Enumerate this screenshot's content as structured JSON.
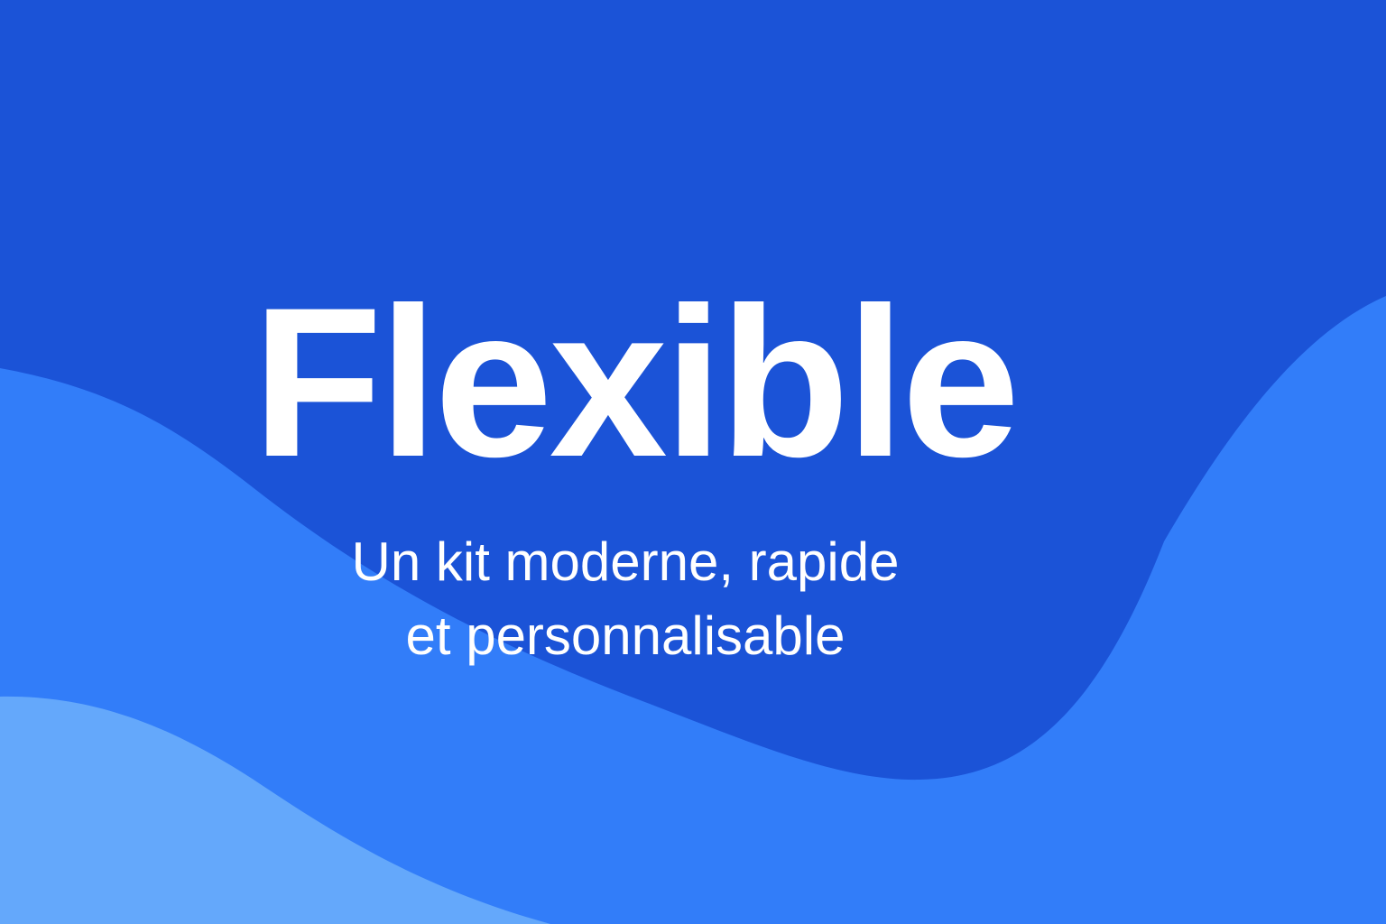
{
  "hero": {
    "title": "Flexible",
    "subtitle_line1": "Un kit moderne, rapide",
    "subtitle_line2": "et personnalisable"
  },
  "colors": {
    "background": "#1b53d7",
    "wave_mid": "#327df9",
    "wave_light": "#64a8fb",
    "text": "#ffffff"
  }
}
